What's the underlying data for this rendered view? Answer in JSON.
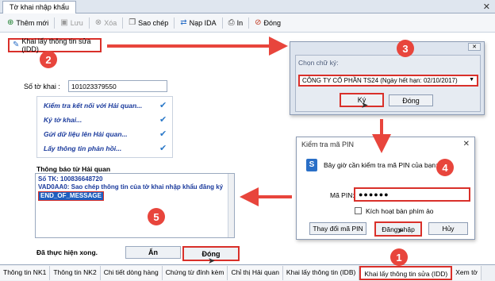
{
  "window": {
    "tab_title": "Tờ khai nhập khẩu",
    "close_glyph": "✕"
  },
  "toolbar": {
    "items": [
      {
        "label": "Thêm mới",
        "icon": "plus-icon",
        "glyph": "⊕",
        "enabled": true
      },
      {
        "label": "Lưu",
        "icon": "save-icon",
        "glyph": "▣",
        "enabled": false
      },
      {
        "label": "Xóa",
        "icon": "delete-icon",
        "glyph": "⊗",
        "enabled": false
      },
      {
        "label": "Sao chép",
        "icon": "copy-icon",
        "glyph": "❐",
        "enabled": true
      },
      {
        "label": "Nạp IDA",
        "icon": "load-icon",
        "glyph": "⇄",
        "enabled": true
      },
      {
        "label": "In",
        "icon": "print-icon",
        "glyph": "⎙",
        "enabled": true
      },
      {
        "label": "Đóng",
        "icon": "close-circle-icon",
        "glyph": "⊘",
        "enabled": true
      }
    ]
  },
  "main": {
    "idd_button_label": "Khai lấy thông tin sửa (IDD)",
    "so_to_khai_label": "Số tờ khai :",
    "so_to_khai_value": "101023379550",
    "steps": [
      {
        "label": "Kiểm tra kết nối với Hải quan...",
        "done": true
      },
      {
        "label": "Ký tờ khai...",
        "done": true
      },
      {
        "label": "Gửi dữ liệu lên Hải quan...",
        "done": true
      },
      {
        "label": "Lấy thông tin phản hồi...",
        "done": true
      }
    ],
    "check_glyph": "✔",
    "thong_bao_label": "Thông báo từ Hải quan",
    "thong_bao_line1": "Số TK: 100836648720",
    "thong_bao_line2": "VAD0AA0: Sao chép thông tin của tờ khai nhập khẩu đăng ký",
    "thong_bao_eom": "END_OF_MESSAGE",
    "done_label": "Đã thực hiện xong.",
    "btn_an": "Ẩn",
    "btn_dong": "Đóng"
  },
  "signature_dialog": {
    "label": "Chọn chữ ký:",
    "selected": "CÔNG TY CỔ PHẦN TS24 (Ngày hết hạn: 02/10/2017)",
    "ok_label": "Ký",
    "cancel_label": "Đóng",
    "close_glyph": "✕"
  },
  "pin_dialog": {
    "title": "Kiểm tra mã PIN",
    "message": "Bây giờ cần kiểm tra mã PIN của bạn:",
    "pin_label": "Mã PIN:",
    "pin_value": "●●●●●●",
    "checkbox_label": "Kích hoạt bàn phím ảo",
    "change_pin_label": "Thay đổi mã PIN",
    "login_label": "Đăng nhập",
    "cancel_label": "Hủy",
    "logo_letter": "S",
    "close_glyph": "✕"
  },
  "bottom_tabs": [
    "Thông tin NK1",
    "Thông tin NK2",
    "Chi tiết dòng hàng",
    "Chứng từ đính kèm",
    "Chỉ thị Hải quan",
    "Khai lấy thông tin (IDB)",
    "Khai lấy thông tin sửa (IDD)",
    "Xem tờ"
  ],
  "annotations": {
    "badges": [
      "1",
      "2",
      "3",
      "4",
      "5"
    ],
    "accent_red": "#e8453c"
  }
}
